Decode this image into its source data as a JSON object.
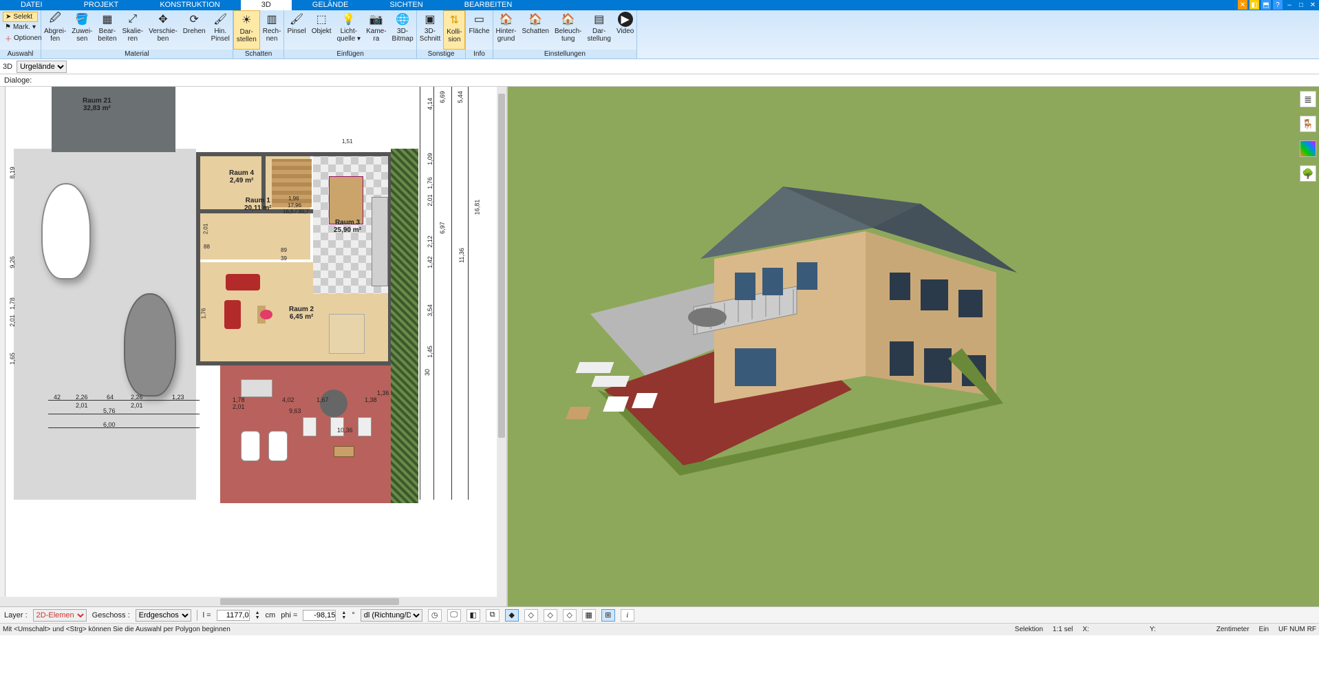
{
  "menu": {
    "items": [
      "DATEI",
      "PROJEKT",
      "KONSTRUKTION",
      "3D",
      "GELÄNDE",
      "SICHTEN",
      "BEARBEITEN"
    ],
    "active": 3
  },
  "ribbon": {
    "auswahl": {
      "label": "Auswahl",
      "selekt": "Selekt",
      "mark": "Mark.",
      "optionen": "Optionen"
    },
    "material": {
      "label": "Material",
      "btns": [
        {
          "l": "Abgrei-\nfen"
        },
        {
          "l": "Zuwei-\nsen"
        },
        {
          "l": "Bear-\nbeiten"
        },
        {
          "l": "Skalie-\nren"
        },
        {
          "l": "Verschie-\nben"
        },
        {
          "l": "Drehen"
        },
        {
          "l": "Hin.\nPinsel"
        }
      ]
    },
    "schatten": {
      "label": "Schatten",
      "btns": [
        {
          "l": "Dar-\nstellen",
          "sel": true
        },
        {
          "l": "Rech-\nnen"
        }
      ]
    },
    "einfuegen": {
      "label": "Einfügen",
      "btns": [
        {
          "l": "Pinsel"
        },
        {
          "l": "Objekt"
        },
        {
          "l": "Licht-\nquelle ▾"
        },
        {
          "l": "Kame-\nra"
        },
        {
          "l": "3D-\nBitmap"
        }
      ]
    },
    "sonstige": {
      "label": "Sonstige",
      "btns": [
        {
          "l": "3D-\nSchnitt"
        },
        {
          "l": "Kolli-\nsion",
          "sel": true
        }
      ]
    },
    "info": {
      "label": "Info",
      "btns": [
        {
          "l": "Fläche"
        }
      ]
    },
    "einstellungen": {
      "label": "Einstellungen",
      "btns": [
        {
          "l": "Hinter-\ngrund"
        },
        {
          "l": "Schatten"
        },
        {
          "l": "Beleuch-\ntung"
        },
        {
          "l": "Dar-\nstellung"
        },
        {
          "l": "Video"
        }
      ]
    }
  },
  "viewrow": {
    "label": "3D",
    "dropdown": "Urgelände"
  },
  "dlgrow": {
    "label": "Dialoge:"
  },
  "rooms": {
    "r21": "Raum 21\n32,83 m²",
    "r4": "Raum 4\n2,49 m²",
    "r1": "Raum 1\n20,11 m²",
    "r3": "Raum 3\n25,90 m²",
    "r2": "Raum 2\n6,45 m²"
  },
  "dims": {
    "top_right": [
      "6,69",
      "5,44"
    ],
    "right_side": [
      "4,14",
      "1,09",
      "1,76",
      "2,01",
      "6,97",
      "16,81",
      "11,36",
      "2,12",
      "1,42",
      "3,54",
      "1,45",
      "30"
    ],
    "left_side": [
      "8,19",
      "9,26",
      "1,78",
      "2,01",
      "1,65"
    ],
    "bottom": [
      "42",
      "2,26",
      "2,01",
      "64",
      "2,26",
      "2,01",
      "1,23",
      "5,76",
      "6,00",
      "1,78",
      "2,01",
      "4,02",
      "9,63",
      "1,67",
      "10,36",
      "1,38",
      "1,36"
    ],
    "inside": [
      "1,51",
      "1,96",
      "17,96",
      "16,5 / 30,7",
      "2,01",
      "88",
      "89",
      "39"
    ]
  },
  "bottombar": {
    "layer_lbl": "Layer :",
    "layer_val": "2D-Elemen",
    "geschoss_lbl": "Geschoss :",
    "geschoss_val": "Erdgeschos",
    "l_lbl": "l =",
    "l_val": "1177,0",
    "l_unit": "cm",
    "phi_lbl": "phi =",
    "phi_val": "-98,15",
    "phi_unit": "°",
    "mode": "dl (Richtung/Di"
  },
  "statusbar": {
    "hint": "Mit <Umschalt> und <Strg> können Sie die Auswahl per Polygon beginnen",
    "sel": "Selektion",
    "ratio": "1:1 sel",
    "x": "X:",
    "y": "Y:",
    "unit": "Zentimeter",
    "ein": "Ein",
    "uf": "UF NUM RF"
  }
}
